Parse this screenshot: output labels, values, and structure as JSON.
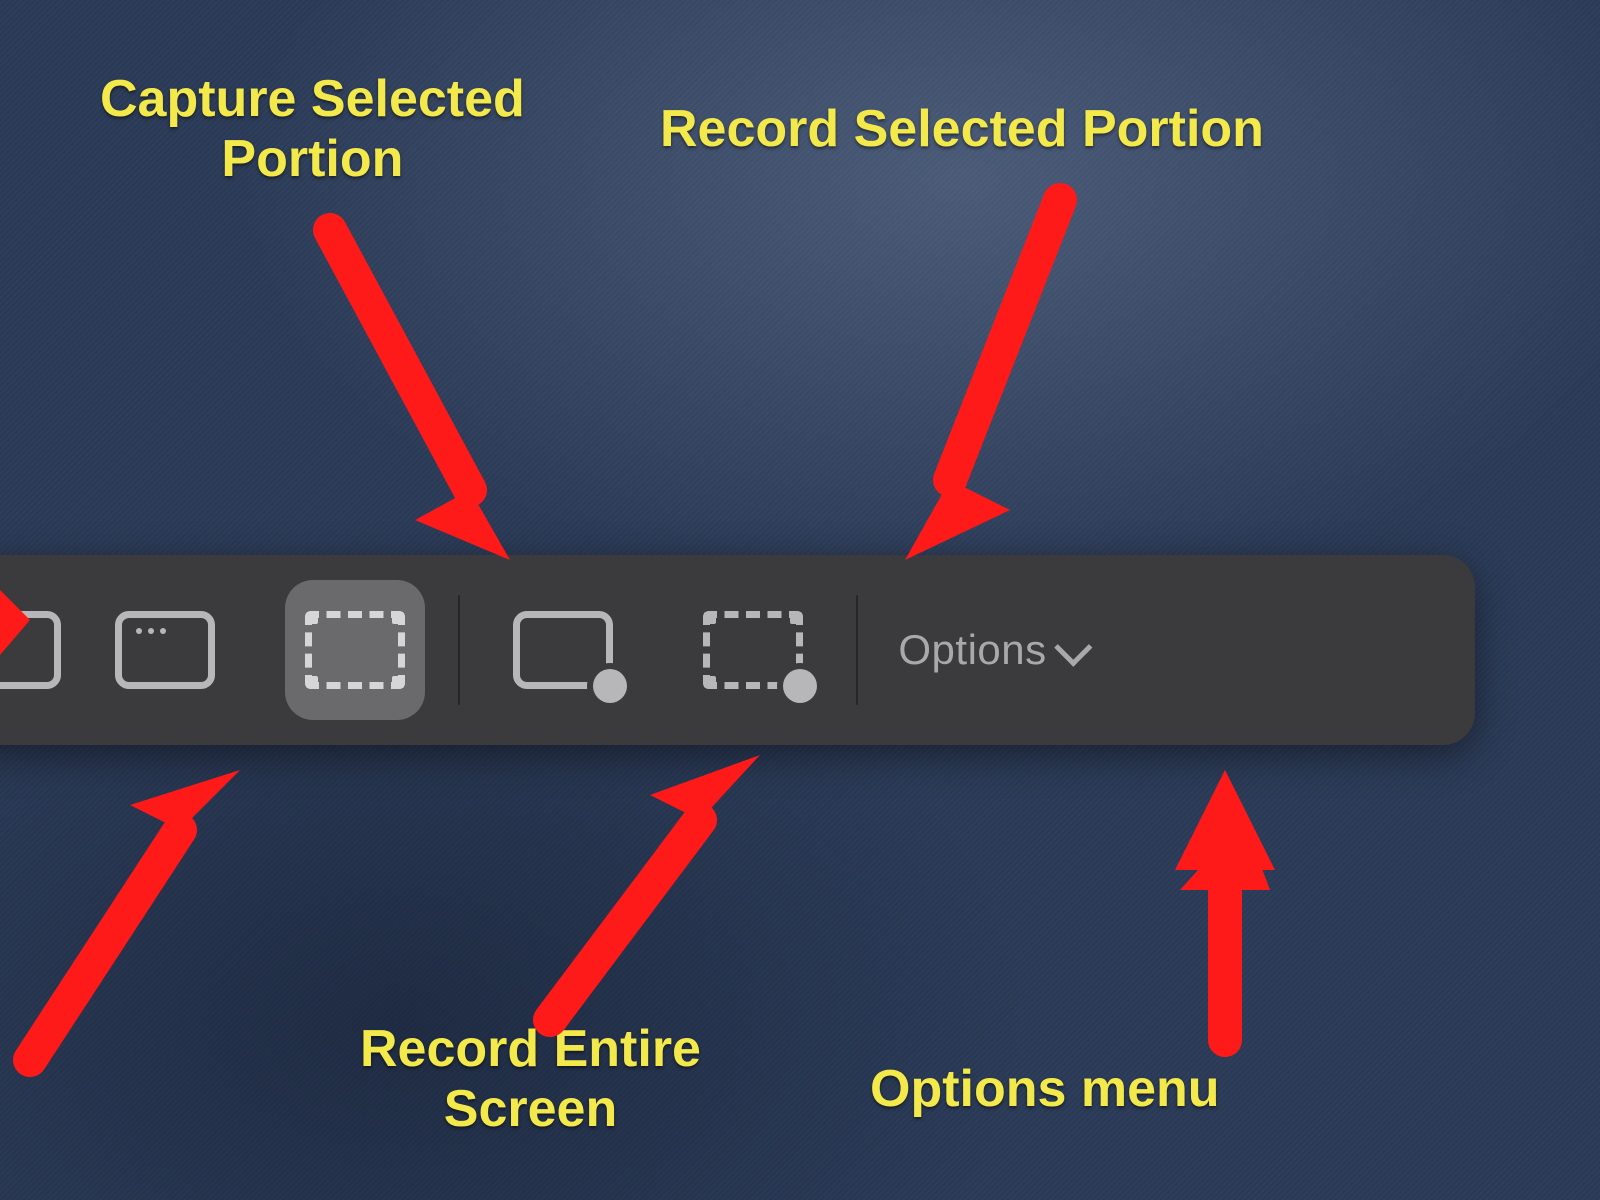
{
  "annotations": {
    "capture_selected_portion": "Capture Selected\nPortion",
    "record_selected_portion": "Record Selected Portion",
    "record_entire_screen": "Record Entire\nScreen",
    "options_menu": "Options menu"
  },
  "toolbar": {
    "options_label": "Options",
    "buttons": {
      "capture_entire_screen": "Capture Entire Screen",
      "capture_window": "Capture Selected Window",
      "capture_selected_portion": "Capture Selected Portion",
      "record_entire_screen": "Record Entire Screen",
      "record_selected_portion": "Record Selected Portion"
    },
    "selected": "capture_selected_portion"
  },
  "colors": {
    "annotation_text": "#f4e94b",
    "arrow": "#ff1a1a",
    "toolbar_bg": "#3b3b3d",
    "toolbar_icon": "#b7b7b9",
    "toolbar_selected": "#6a6a6d"
  }
}
